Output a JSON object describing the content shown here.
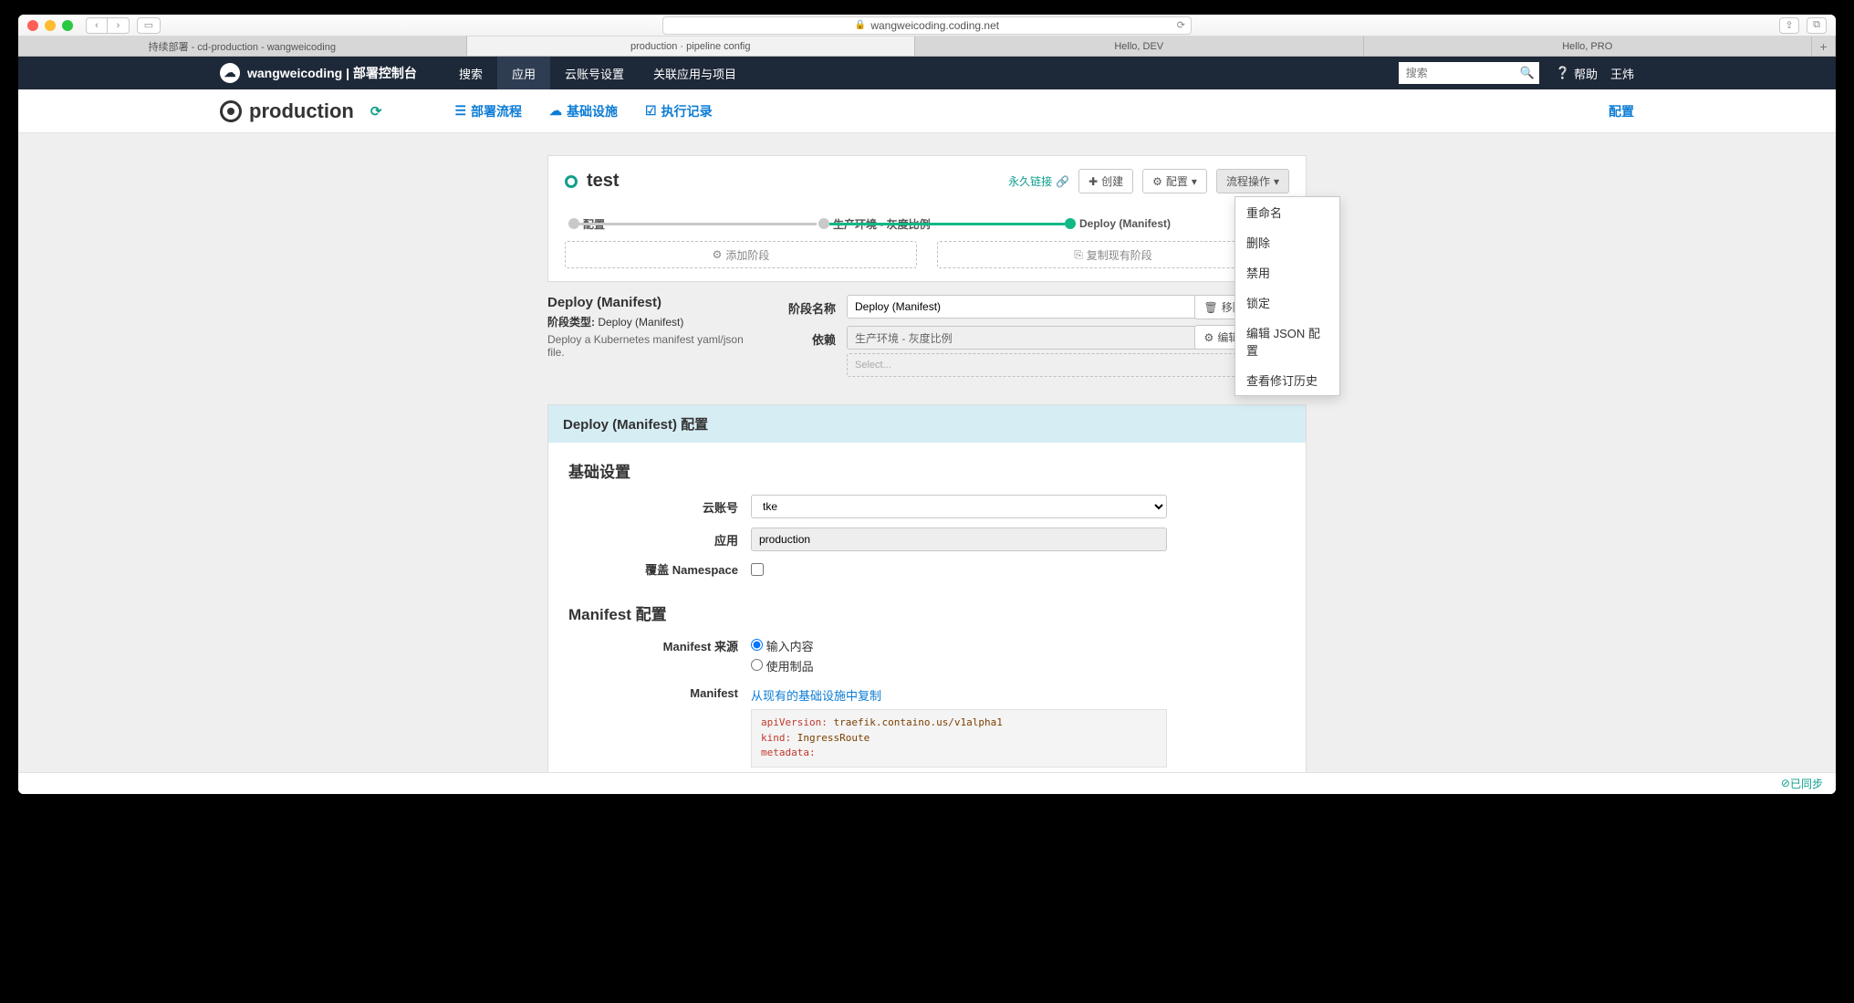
{
  "browser": {
    "url": "wangweicoding.coding.net",
    "tabs": [
      "持续部署 - cd-production - wangweicoding",
      "production · pipeline config",
      "Hello, DEV",
      "Hello, PRO"
    ],
    "active_tab_index": 1
  },
  "appbar": {
    "brand": "wangweicoding | 部署控制台",
    "nav": [
      "搜索",
      "应用",
      "云账号设置",
      "关联应用与项目"
    ],
    "active_nav_index": 1,
    "search_placeholder": "搜索",
    "help": "帮助",
    "user": "王炜"
  },
  "subheader": {
    "app_name": "production",
    "tabs": {
      "pipeline": "部署流程",
      "infra": "基础设施",
      "exec": "执行记录"
    },
    "config": "配置"
  },
  "pipeline": {
    "name": "test",
    "permalink": "永久链接",
    "create_btn": "创建",
    "config_btn": "配置",
    "actions_btn": "流程操作",
    "actions_menu": [
      "重命名",
      "删除",
      "禁用",
      "锁定",
      "编辑 JSON 配置",
      "查看修订历史"
    ],
    "stages": {
      "s1": "配置",
      "s2": "生产环境 - 灰度比例",
      "s3": "Deploy (Manifest)"
    },
    "add_stage": "添加阶段",
    "copy_stage": "复制现有阶段"
  },
  "stage_detail": {
    "title": "Deploy (Manifest)",
    "type_label": "阶段类型:",
    "type_value": "Deploy (Manifest)",
    "desc": "Deploy a Kubernetes manifest yaml/json file.",
    "name_label": "阶段名称",
    "name_value": "Deploy (Manifest)",
    "dep_label": "依赖",
    "dep_value": "生产环境 - 灰度比例",
    "dep_placeholder": "Select...",
    "remove_btn": "移除阶段",
    "edit_json_btn": "编辑 JSON 配置"
  },
  "deploy_cfg": {
    "header": "Deploy (Manifest) 配置",
    "basic_title": "基础设置",
    "account_label": "云账号",
    "account_value": "tke",
    "app_label": "应用",
    "app_value": "production",
    "ns_label": "覆盖 Namespace",
    "manifest_title": "Manifest 配置",
    "source_label": "Manifest 来源",
    "source_opt1": "输入内容",
    "source_opt2": "使用制品",
    "manifest_label": "Manifest",
    "copy_link": "从现有的基础设施中复制",
    "code": {
      "l1a": "apiVersion:",
      "l1b": " traefik.containo.us/v1alpha1",
      "l2a": "kind:",
      "l2b": " IngressRoute",
      "l3a": "metadata:"
    }
  },
  "footer": {
    "sync": "已同步"
  }
}
